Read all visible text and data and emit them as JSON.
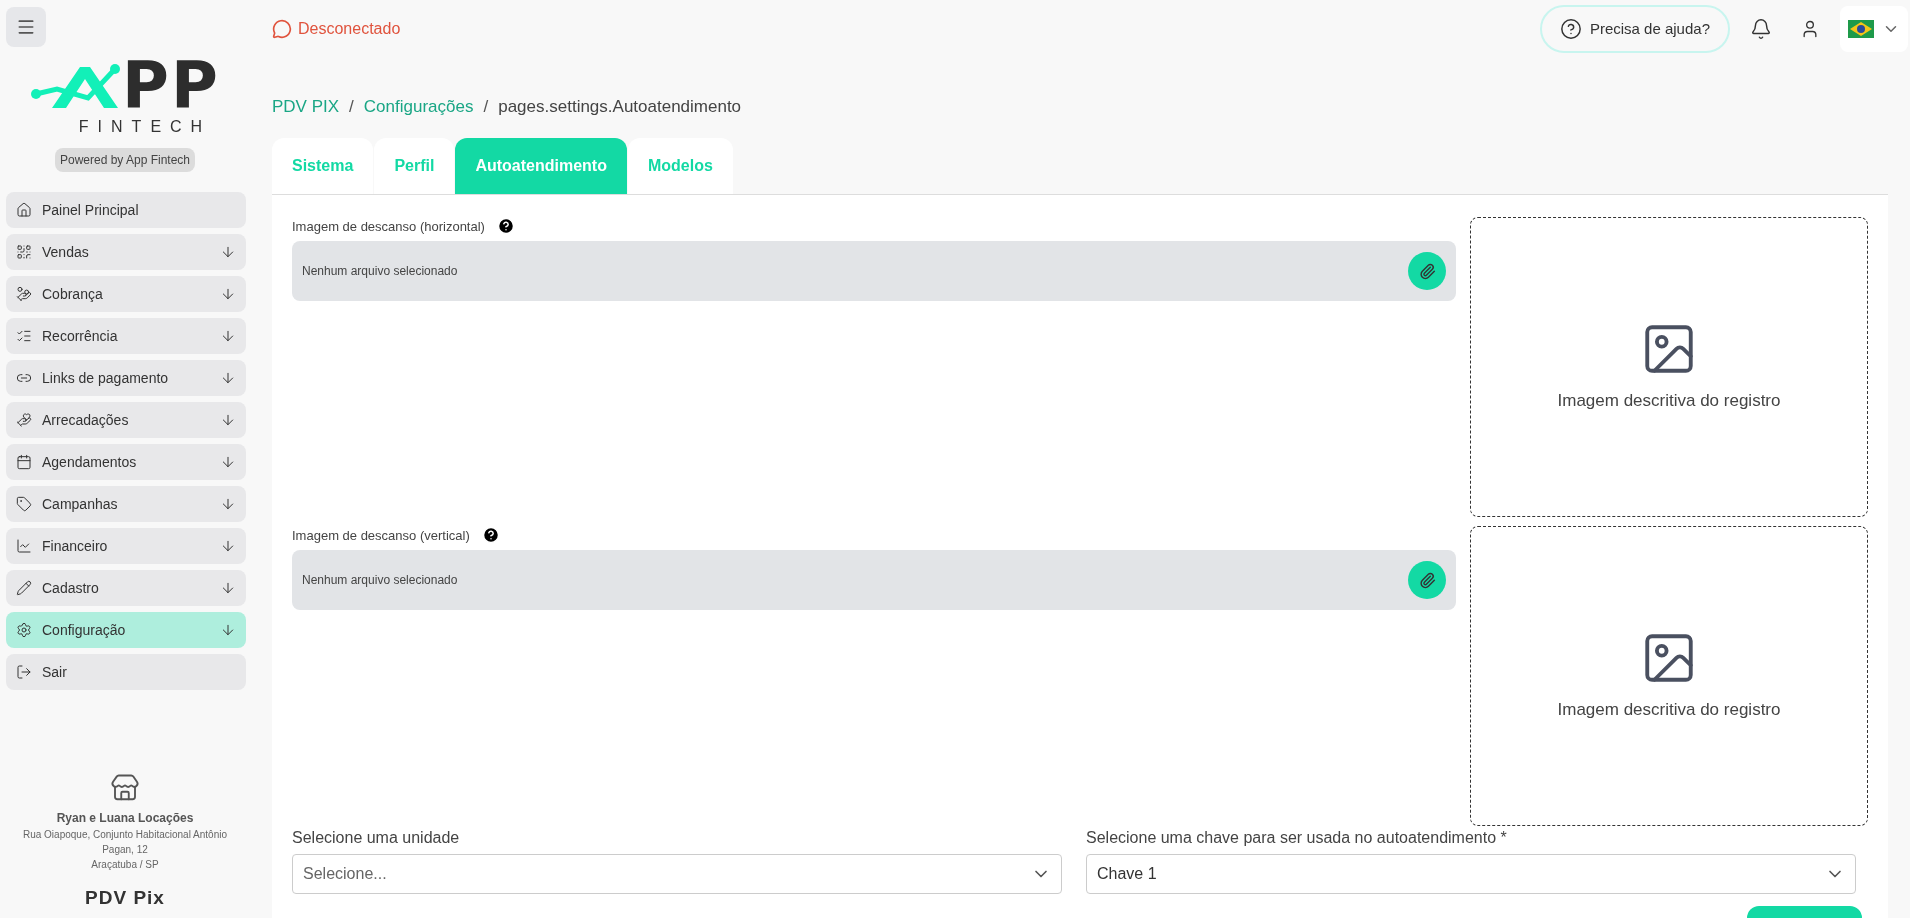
{
  "sidebar": {
    "logo": {
      "mark_text": "PP",
      "subtitle": "FINTECH"
    },
    "powered_by": "Powered by App Fintech",
    "items": [
      {
        "label": "Painel Principal",
        "expandable": false,
        "selected": false
      },
      {
        "label": "Vendas",
        "expandable": true,
        "selected": false
      },
      {
        "label": "Cobrança",
        "expandable": true,
        "selected": false
      },
      {
        "label": "Recorrência",
        "expandable": true,
        "selected": false
      },
      {
        "label": "Links de pagamento",
        "expandable": true,
        "selected": false
      },
      {
        "label": "Arrecadações",
        "expandable": true,
        "selected": false
      },
      {
        "label": "Agendamentos",
        "expandable": true,
        "selected": false
      },
      {
        "label": "Campanhas",
        "expandable": true,
        "selected": false
      },
      {
        "label": "Financeiro",
        "expandable": true,
        "selected": false
      },
      {
        "label": "Cadastro",
        "expandable": true,
        "selected": false
      },
      {
        "label": "Configuração",
        "expandable": true,
        "selected": true
      },
      {
        "label": "Sair",
        "expandable": false,
        "selected": false
      }
    ],
    "store": {
      "name": "Ryan e Luana Locações",
      "address": "Rua Oiapoque, Conjunto Habitacional Antônio Pagan, 12",
      "city": "Araçatuba / SP"
    },
    "product": "PDV Pix"
  },
  "top_bar": {
    "whatsapp_status": "Desconectado",
    "help_button": "Precisa de ajuda?"
  },
  "breadcrumb": [
    {
      "kind": "link",
      "label": "PDV PIX"
    },
    {
      "kind": "separator",
      "label": "/"
    },
    {
      "kind": "link",
      "label": "Configurações"
    },
    {
      "kind": "separator",
      "label": "/"
    },
    {
      "kind": "current",
      "label": "pages.settings.Autoatendimento"
    }
  ],
  "tabs": [
    {
      "label": "Sistema",
      "selected": false
    },
    {
      "label": "Perfil",
      "selected": false
    },
    {
      "label": "Autoatendimento",
      "selected": true
    },
    {
      "label": "Modelos",
      "selected": false
    }
  ],
  "image_fields": [
    {
      "label": "Imagem de descanso (horizontal)",
      "value": "Nenhum arquivo selecionado",
      "preview_caption": "Imagem descritiva do registro"
    },
    {
      "label": "Imagem de descanso (vertical)",
      "value": "Nenhum arquivo selecionado",
      "preview_caption": "Imagem descritiva do registro"
    }
  ],
  "selects": [
    {
      "label": "Selecione uma unidade",
      "value": "Selecione...",
      "placeholder_shown": true
    },
    {
      "label": "Selecione uma chave para ser usada no autoatendimento *",
      "value": "Chave 1",
      "placeholder_shown": false
    }
  ]
}
